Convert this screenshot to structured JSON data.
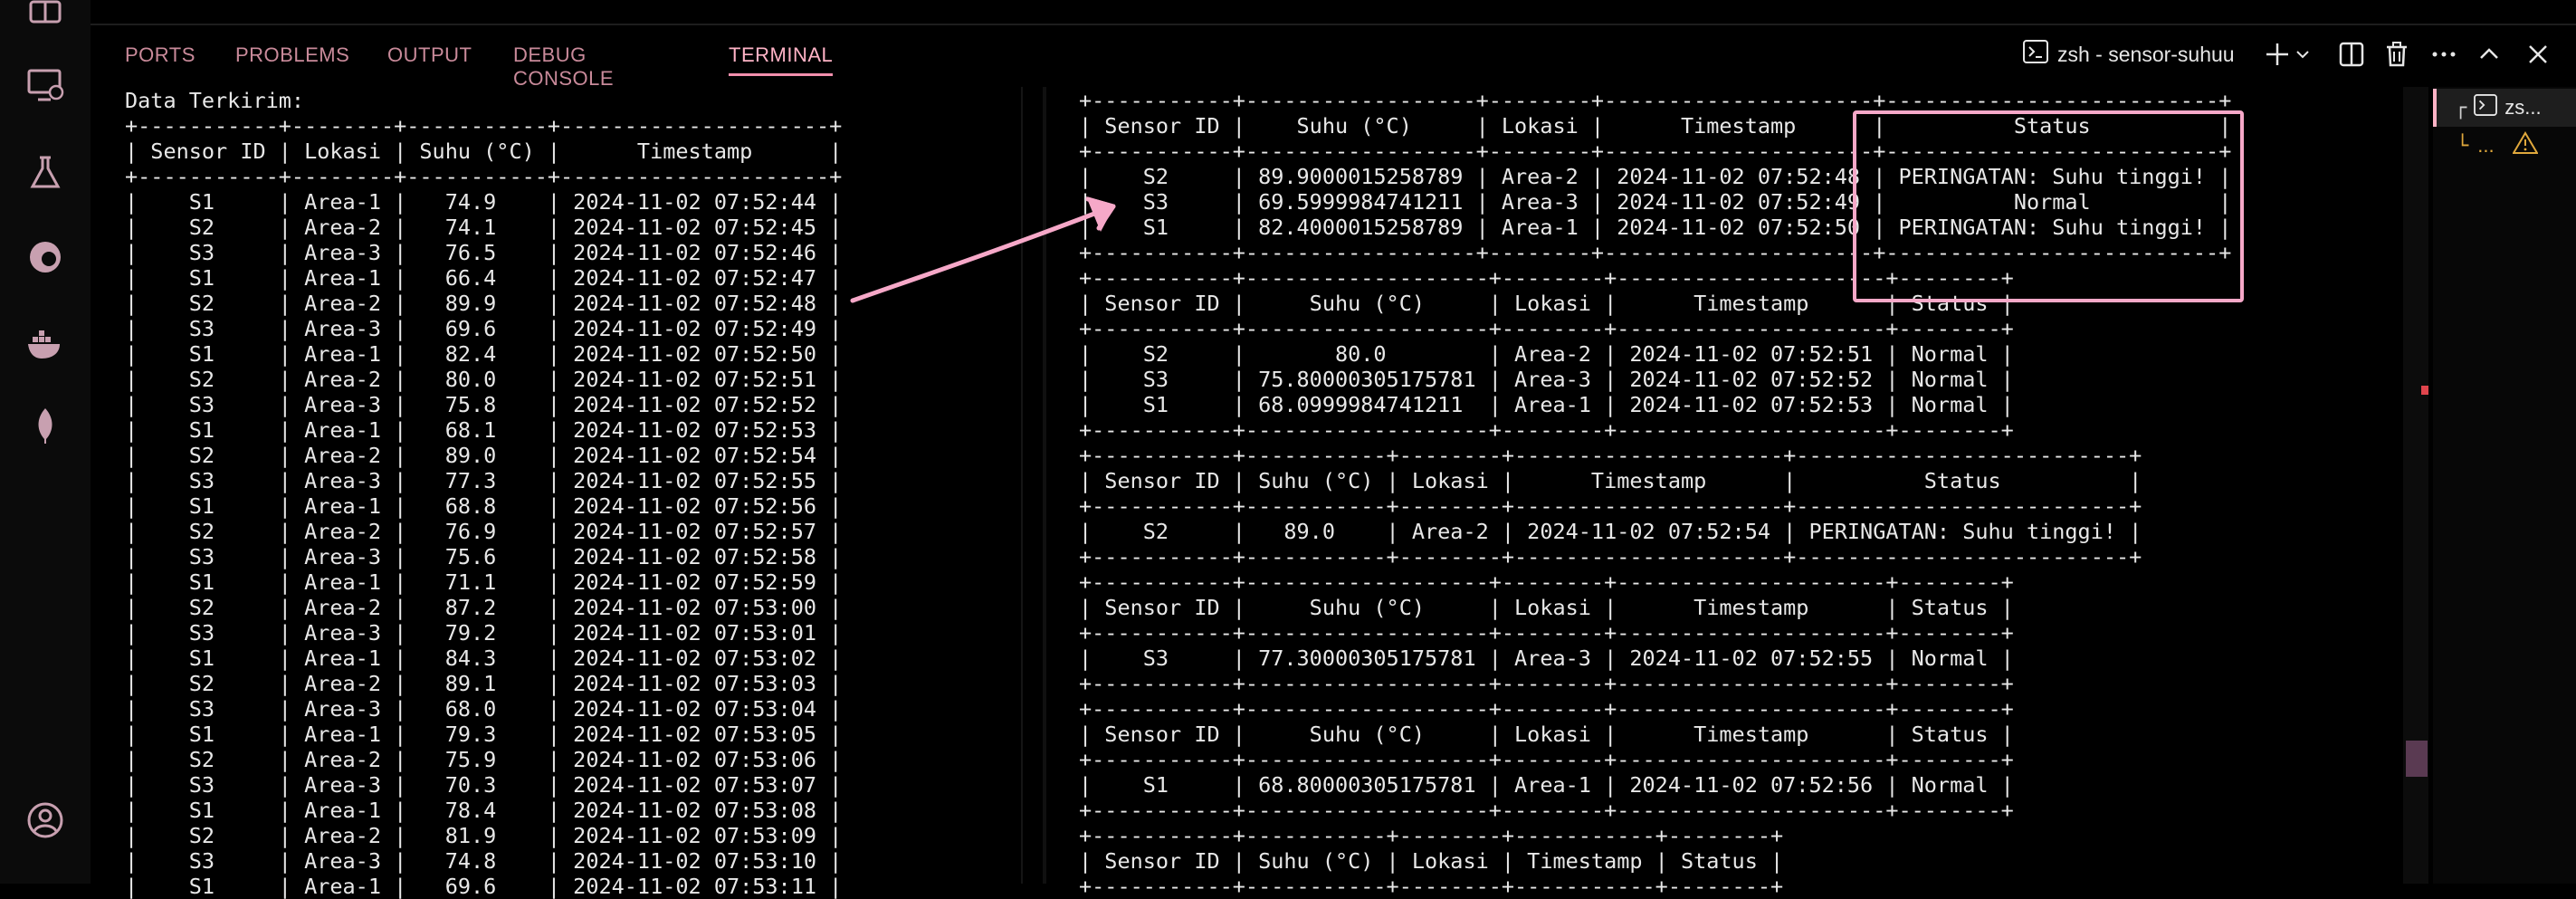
{
  "panel": {
    "tabs": [
      "PORTS",
      "PROBLEMS",
      "OUTPUT",
      "DEBUG CONSOLE",
      "TERMINAL"
    ],
    "active_tab": "TERMINAL",
    "terminal_title": "zsh - sensor-suhuu"
  },
  "side_list": {
    "items": [
      "zs...",
      "..."
    ]
  },
  "icons": {
    "activity": [
      "explorer-icon",
      "remote-explorer-icon",
      "testing-flask-icon",
      "edge-browser-icon",
      "docker-icon",
      "mongodb-leaf-icon",
      "account-icon"
    ],
    "actions": [
      "terminal-icon",
      "add-icon",
      "chevron-down-icon",
      "split-icon",
      "trash-icon",
      "ellipsis-icon",
      "chevron-up-icon",
      "close-icon"
    ]
  },
  "colors": {
    "accent": "#f28fad",
    "highlight": "#f6a8c8",
    "warning": "#e0a83c"
  },
  "left_terminal": {
    "heading": "Data Terkirim:",
    "headers": [
      "Sensor ID",
      "Lokasi",
      "Suhu (°C)",
      "Timestamp"
    ],
    "rows": [
      [
        "S1",
        "Area-1",
        "74.9",
        "2024-11-02 07:52:44"
      ],
      [
        "S2",
        "Area-2",
        "74.1",
        "2024-11-02 07:52:45"
      ],
      [
        "S3",
        "Area-3",
        "76.5",
        "2024-11-02 07:52:46"
      ],
      [
        "S1",
        "Area-1",
        "66.4",
        "2024-11-02 07:52:47"
      ],
      [
        "S2",
        "Area-2",
        "89.9",
        "2024-11-02 07:52:48"
      ],
      [
        "S3",
        "Area-3",
        "69.6",
        "2024-11-02 07:52:49"
      ],
      [
        "S1",
        "Area-1",
        "82.4",
        "2024-11-02 07:52:50"
      ],
      [
        "S2",
        "Area-2",
        "80.0",
        "2024-11-02 07:52:51"
      ],
      [
        "S3",
        "Area-3",
        "75.8",
        "2024-11-02 07:52:52"
      ],
      [
        "S1",
        "Area-1",
        "68.1",
        "2024-11-02 07:52:53"
      ],
      [
        "S2",
        "Area-2",
        "89.0",
        "2024-11-02 07:52:54"
      ],
      [
        "S3",
        "Area-3",
        "77.3",
        "2024-11-02 07:52:55"
      ],
      [
        "S1",
        "Area-1",
        "68.8",
        "2024-11-02 07:52:56"
      ],
      [
        "S2",
        "Area-2",
        "76.9",
        "2024-11-02 07:52:57"
      ],
      [
        "S3",
        "Area-3",
        "75.6",
        "2024-11-02 07:52:58"
      ],
      [
        "S1",
        "Area-1",
        "71.1",
        "2024-11-02 07:52:59"
      ],
      [
        "S2",
        "Area-2",
        "87.2",
        "2024-11-02 07:53:00"
      ],
      [
        "S3",
        "Area-3",
        "79.2",
        "2024-11-02 07:53:01"
      ],
      [
        "S1",
        "Area-1",
        "84.3",
        "2024-11-02 07:53:02"
      ],
      [
        "S2",
        "Area-2",
        "89.1",
        "2024-11-02 07:53:03"
      ],
      [
        "S3",
        "Area-3",
        "68.0",
        "2024-11-02 07:53:04"
      ],
      [
        "S1",
        "Area-1",
        "79.3",
        "2024-11-02 07:53:05"
      ],
      [
        "S2",
        "Area-2",
        "75.9",
        "2024-11-02 07:53:06"
      ],
      [
        "S3",
        "Area-3",
        "70.3",
        "2024-11-02 07:53:07"
      ],
      [
        "S1",
        "Area-1",
        "78.4",
        "2024-11-02 07:53:08"
      ],
      [
        "S2",
        "Area-2",
        "81.9",
        "2024-11-02 07:53:09"
      ],
      [
        "S3",
        "Area-3",
        "74.8",
        "2024-11-02 07:53:10"
      ],
      [
        "S1",
        "Area-1",
        "69.6",
        "2024-11-02 07:53:11"
      ]
    ]
  },
  "right_terminal": {
    "headers": [
      "Sensor ID",
      "Suhu (°C)",
      "Lokasi",
      "Timestamp",
      "Status"
    ],
    "tables": [
      {
        "rows": [
          [
            "S2",
            "89.9000015258789",
            "Area-2",
            "2024-11-02 07:52:48",
            "PERINGATAN: Suhu tinggi!"
          ],
          [
            "S3",
            "69.5999984741211",
            "Area-3",
            "2024-11-02 07:52:49",
            "Normal"
          ],
          [
            "S1",
            "82.4000015258789",
            "Area-1",
            "2024-11-02 07:52:50",
            "PERINGATAN: Suhu tinggi!"
          ]
        ]
      },
      {
        "rows": [
          [
            "S2",
            "80.0",
            "Area-2",
            "2024-11-02 07:52:51",
            "Normal"
          ],
          [
            "S3",
            "75.80000305175781",
            "Area-3",
            "2024-11-02 07:52:52",
            "Normal"
          ],
          [
            "S1",
            "68.0999984741211",
            "Area-1",
            "2024-11-02 07:52:53",
            "Normal"
          ]
        ]
      },
      {
        "rows": [
          [
            "S2",
            "89.0",
            "Area-2",
            "2024-11-02 07:52:54",
            "PERINGATAN: Suhu tinggi!"
          ]
        ]
      },
      {
        "rows": [
          [
            "S3",
            "77.30000305175781",
            "Area-3",
            "2024-11-02 07:52:55",
            "Normal"
          ]
        ]
      },
      {
        "rows": [
          [
            "S1",
            "68.80000305175781",
            "Area-1",
            "2024-11-02 07:52:56",
            "Normal"
          ]
        ]
      },
      {
        "rows": []
      }
    ]
  }
}
